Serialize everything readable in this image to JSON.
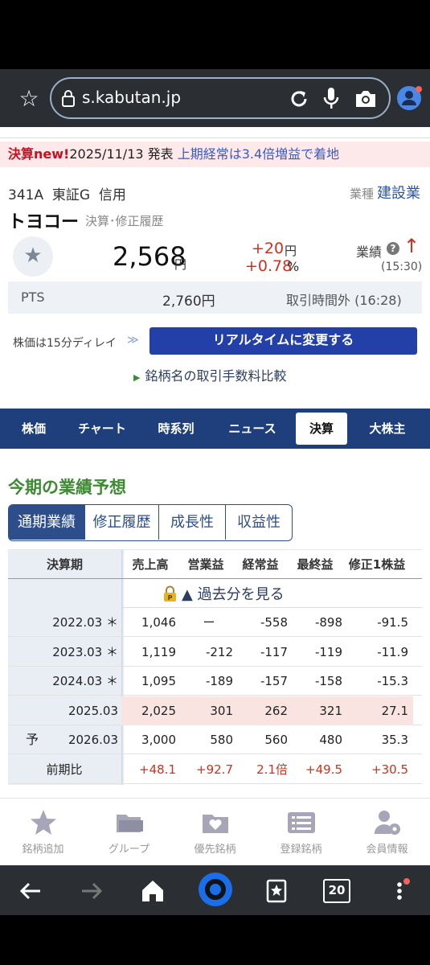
{
  "browser": {
    "url": "s.kabutan.jp",
    "tab_count": "20"
  },
  "notice": {
    "tag": "決算new!",
    "date": "2025/11/13 発表",
    "headline": "上期経常は3.4倍増益で着地"
  },
  "stock": {
    "code_line": "341A  東証G  信用",
    "sector_label": "業種",
    "sector": "建設業",
    "name": "トヨコー",
    "name_link": "決算･修正履歴",
    "price": "2,568",
    "price_unit": "円",
    "change_abs": "+20",
    "change_abs_unit": "円",
    "change_pct": "+0.78",
    "change_pct_unit": "%",
    "perf_label": "業績",
    "perf_time": "(15:30)",
    "pts_label": "PTS",
    "pts_price": "2,760円",
    "pts_time": "取引時間外 (16:28)",
    "delay_text": "株価は15分ディレイ",
    "realtime_button": "リアルタイムに変更する",
    "compare_link": "銘柄名の取引手数料比較"
  },
  "tabs": [
    "株価",
    "チャート",
    "時系列",
    "ニュース",
    "決算",
    "大株主"
  ],
  "active_tab": "決算",
  "section": {
    "title": "今期の業績予想",
    "subtabs": [
      "通期業績",
      "修正履歴",
      "成長性",
      "収益性"
    ]
  },
  "table": {
    "headers": [
      "決算期",
      "売上高",
      "営業益",
      "経常益",
      "最終益",
      "修正1株益"
    ],
    "past_link": "▲ 過去分を見る",
    "rows": [
      {
        "prefix": "",
        "period": "2022.03 ＊",
        "values": [
          "1,046",
          "ー",
          "-558",
          "-898",
          "-91.5"
        ]
      },
      {
        "prefix": "",
        "period": "2023.03 ＊",
        "values": [
          "1,119",
          "-212",
          "-117",
          "-119",
          "-11.9"
        ]
      },
      {
        "prefix": "",
        "period": "2024.03 ＊",
        "values": [
          "1,095",
          "-189",
          "-157",
          "-158",
          "-15.3"
        ]
      },
      {
        "prefix": "",
        "period": "2025.03",
        "values": [
          "2,025",
          "301",
          "262",
          "321",
          "27.1"
        ]
      },
      {
        "prefix": "予",
        "period": "2026.03",
        "values": [
          "3,000",
          "580",
          "560",
          "480",
          "35.3"
        ]
      },
      {
        "prefix": "",
        "period": "前期比",
        "values": [
          "+48.1",
          "+92.7",
          "2.1倍",
          "+49.5",
          "+30.5"
        ]
      }
    ]
  },
  "bottom_nav": [
    "銘柄追加",
    "グループ",
    "優先銘柄",
    "登録銘柄",
    "会員情報"
  ],
  "colors": {
    "navy": "#1e3f7c",
    "button_blue": "#2240a8",
    "up_red": "#d0301b",
    "section_green": "#3e8a33"
  }
}
